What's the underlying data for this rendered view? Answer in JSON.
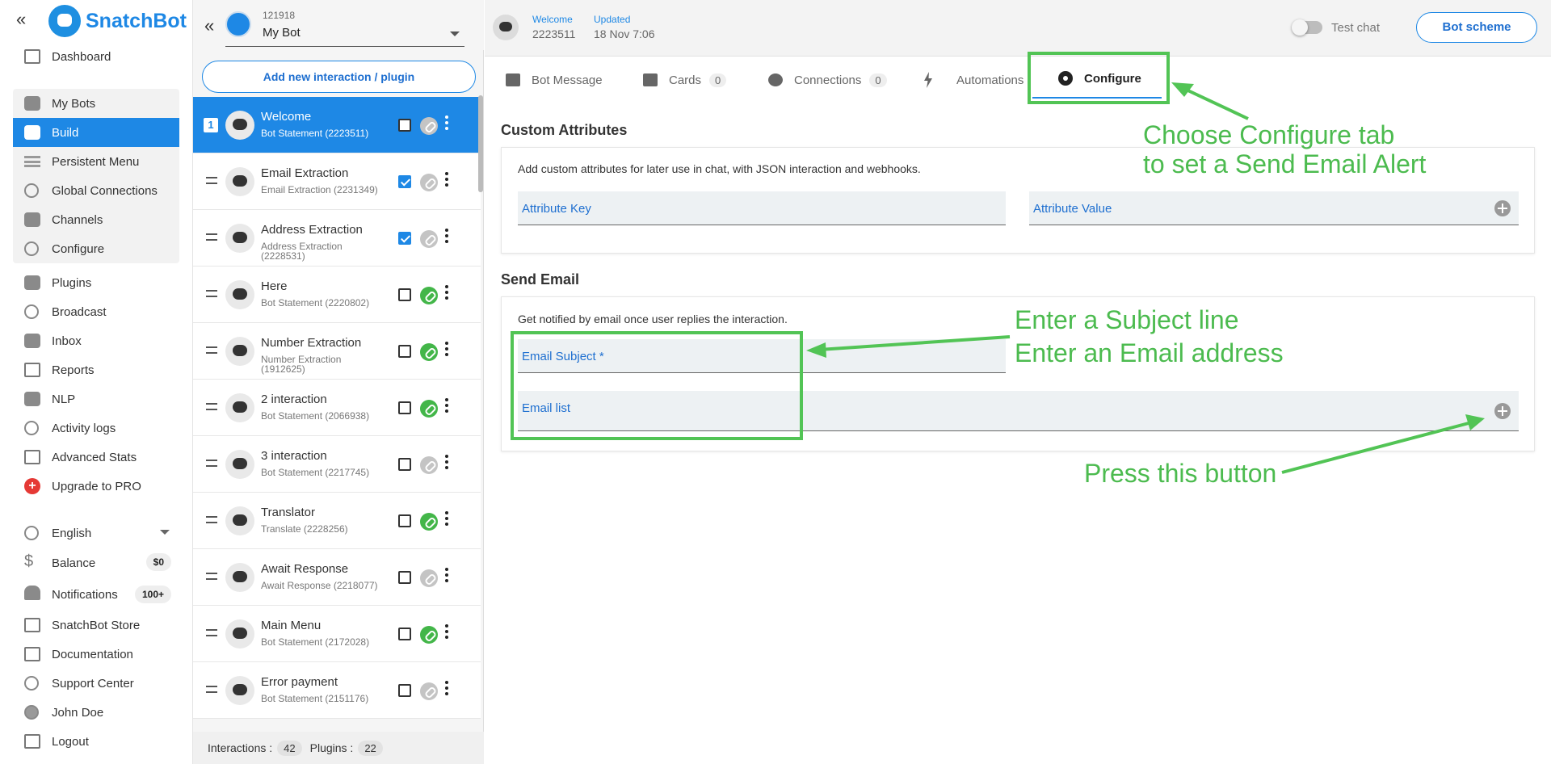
{
  "app": {
    "brand": "SnatchBot",
    "brand_color": "#1e88e5"
  },
  "nav": {
    "items": [
      {
        "label": "Dashboard",
        "icon": "dashboard-icon"
      },
      {
        "label": "My Bots",
        "icon": "robot-icon"
      },
      {
        "label": "Build",
        "icon": "edit-icon",
        "active": true
      },
      {
        "label": "Persistent Menu",
        "icon": "menu-icon"
      },
      {
        "label": "Global Connections",
        "icon": "link-icon"
      },
      {
        "label": "Channels",
        "icon": "plug-icon"
      },
      {
        "label": "Configure",
        "icon": "gear-icon"
      },
      {
        "label": "Plugins",
        "icon": "puzzle-icon"
      },
      {
        "label": "Broadcast",
        "icon": "broadcast-icon"
      },
      {
        "label": "Inbox",
        "icon": "chat-icon"
      },
      {
        "label": "Reports",
        "icon": "bar-chart-icon"
      },
      {
        "label": "NLP",
        "icon": "nlp-icon"
      },
      {
        "label": "Activity logs",
        "icon": "history-icon"
      },
      {
        "label": "Advanced Stats",
        "icon": "line-chart-icon"
      },
      {
        "label": "Upgrade to PRO",
        "icon": "plus-circle-icon"
      }
    ],
    "bottom": [
      {
        "label": "English",
        "icon": "globe-icon"
      },
      {
        "label": "Balance",
        "icon": "dollar-icon",
        "badge": "$0"
      },
      {
        "label": "Notifications",
        "icon": "bell-icon",
        "badge": "100+"
      },
      {
        "label": "SnatchBot Store",
        "icon": "store-icon"
      },
      {
        "label": "Documentation",
        "icon": "document-icon"
      },
      {
        "label": "Support Center",
        "icon": "help-icon"
      },
      {
        "label": "John Doe",
        "icon": "user-icon"
      },
      {
        "label": "Logout",
        "icon": "logout-icon"
      }
    ]
  },
  "bot": {
    "id": "121918",
    "name": "My Bot",
    "add_button": "Add new interaction / plugin"
  },
  "interactions": [
    {
      "num": "1",
      "title": "Welcome",
      "sub": "Bot Statement (2223511)",
      "checked": false,
      "linked": false,
      "selected": true
    },
    {
      "title": "Email Extraction",
      "sub": "Email Extraction (2231349)",
      "checked": true,
      "linked": false
    },
    {
      "title": "Address Extraction",
      "sub": "Address Extraction (2228531)",
      "checked": true,
      "linked": false
    },
    {
      "title": "Here",
      "sub": "Bot Statement (2220802)",
      "checked": false,
      "linked": true
    },
    {
      "title": "Number Extraction",
      "sub": "Number Extraction (1912625)",
      "checked": false,
      "linked": true
    },
    {
      "title": "2 interaction",
      "sub": "Bot Statement (2066938)",
      "checked": false,
      "linked": true
    },
    {
      "title": "3 interaction",
      "sub": "Bot Statement (2217745)",
      "checked": false,
      "linked": false
    },
    {
      "title": "Translator",
      "sub": "Translate (2228256)",
      "checked": false,
      "linked": true
    },
    {
      "title": "Await Response",
      "sub": "Await Response (2218077)",
      "checked": false,
      "linked": false
    },
    {
      "title": "Main Menu",
      "sub": "Bot Statement (2172028)",
      "checked": false,
      "linked": true
    },
    {
      "title": "Error payment",
      "sub": "Bot Statement (2151176)",
      "checked": false,
      "linked": false
    }
  ],
  "footer": {
    "interactions_label": "Interactions :",
    "interactions_count": "42",
    "plugins_label": "Plugins :",
    "plugins_count": "22"
  },
  "topbar": {
    "welcome_label": "Welcome",
    "welcome_value": "2223511",
    "updated_label": "Updated",
    "updated_value": "18 Nov 7:06",
    "test_chat": "Test chat",
    "scheme_button": "Bot scheme"
  },
  "tabs": [
    {
      "label": "Bot Message",
      "icon": "message-icon"
    },
    {
      "label": "Cards",
      "icon": "grid-icon",
      "count": "0"
    },
    {
      "label": "Connections",
      "icon": "link-icon",
      "count": "0"
    },
    {
      "label": "Automations",
      "icon": "bolt-icon"
    },
    {
      "label": "Configure",
      "icon": "gear-icon",
      "active": true
    }
  ],
  "custom_attributes": {
    "title": "Custom Attributes",
    "desc": "Add custom attributes for later use in chat, with JSON interaction and webhooks.",
    "key_placeholder": "Attribute Key",
    "value_placeholder": "Attribute Value"
  },
  "send_email": {
    "title": "Send Email",
    "desc": "Get notified by email once user replies the interaction.",
    "subject_placeholder": "Email Subject *",
    "list_placeholder": "Email list"
  },
  "annotations": {
    "configure_line1": "Choose Configure tab",
    "configure_line2": "to set a Send Email Alert",
    "subject_line1": "Enter a Subject line",
    "subject_line2": "Enter an Email address",
    "press": "Press this button",
    "color": "#4cbb4f"
  }
}
